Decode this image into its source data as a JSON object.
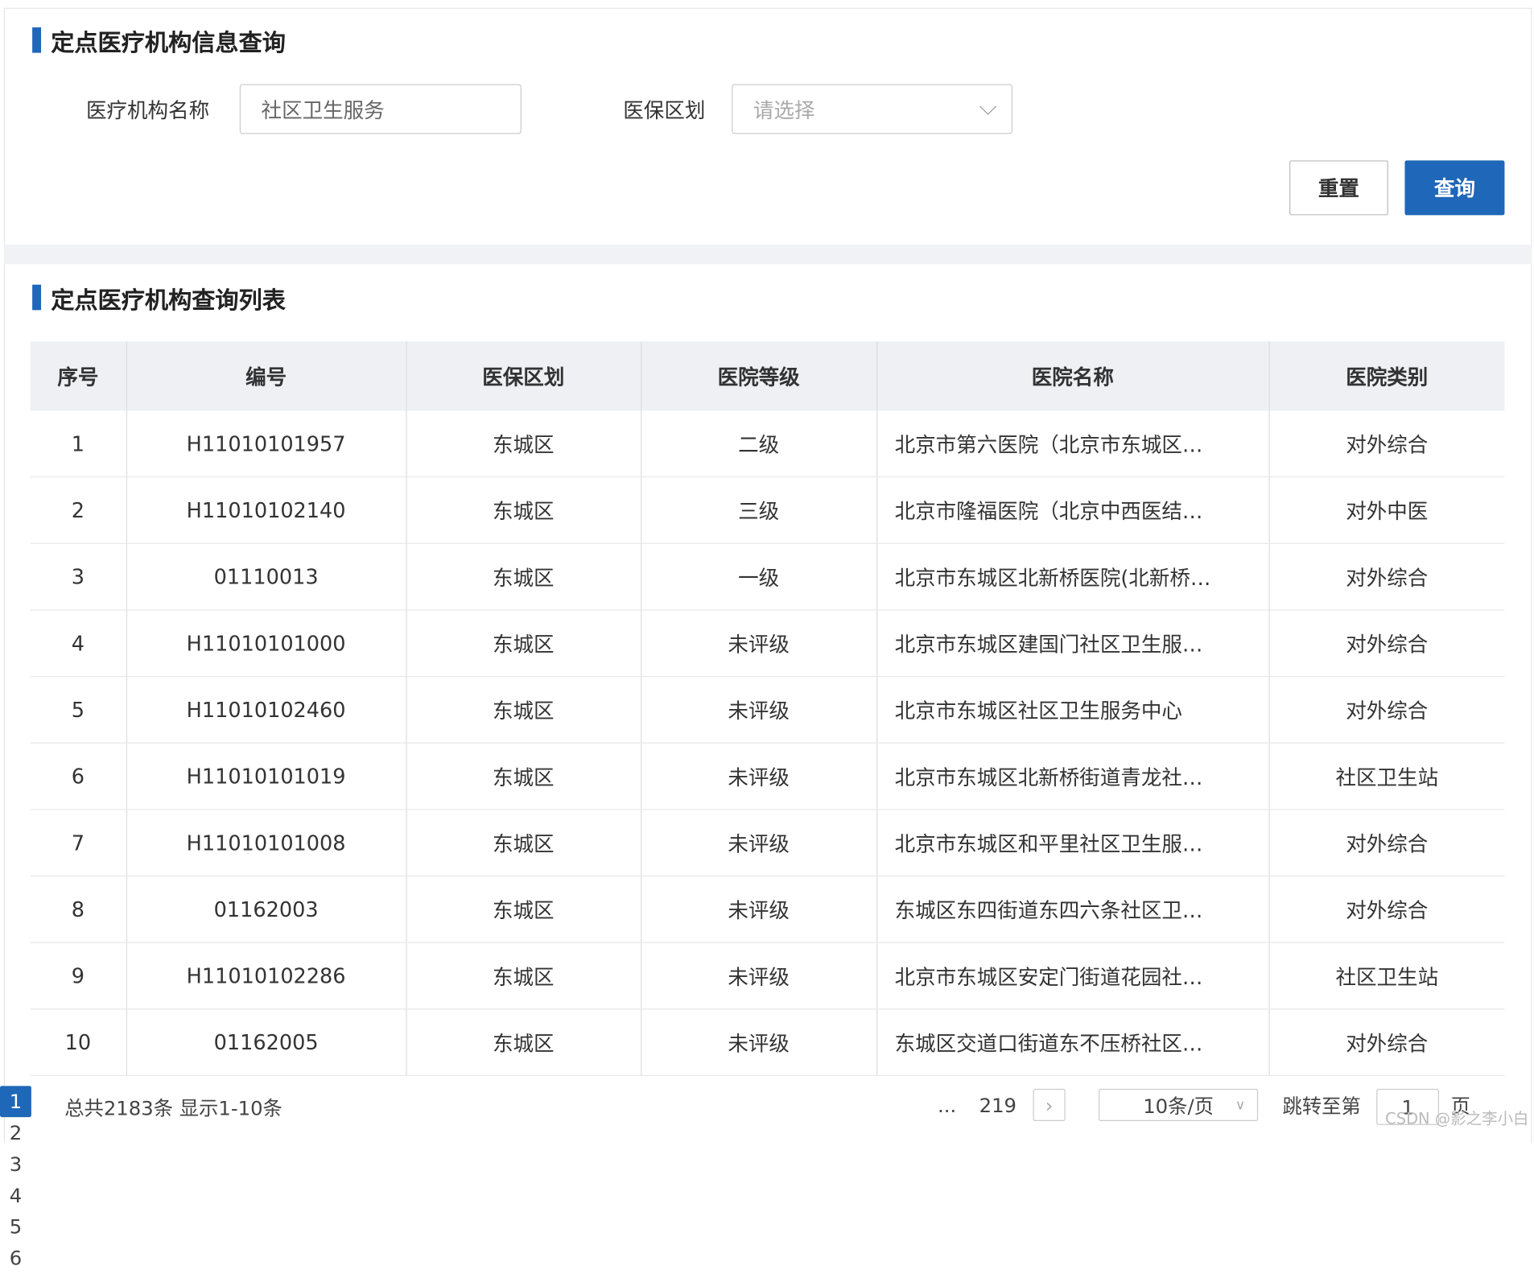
{
  "search": {
    "title": "定点医疗机构信息查询",
    "name_label": "医疗机构名称",
    "name_value": "社区卫生服务",
    "district_label": "医保区划",
    "district_placeholder": "请选择",
    "reset": "重置",
    "query": "查询"
  },
  "list": {
    "title": "定点医疗机构查询列表",
    "columns": [
      "序号",
      "编号",
      "医保区划",
      "医院等级",
      "医院名称",
      "医院类别"
    ],
    "rows": [
      [
        "1",
        "H11010101957",
        "东城区",
        "二级",
        "北京市第六医院（北京市东城区…",
        "对外综合"
      ],
      [
        "2",
        "H11010102140",
        "东城区",
        "三级",
        "北京市隆福医院（北京中西医结…",
        "对外中医"
      ],
      [
        "3",
        "01110013",
        "东城区",
        "一级",
        "北京市东城区北新桥医院(北新桥…",
        "对外综合"
      ],
      [
        "4",
        "H11010101000",
        "东城区",
        "未评级",
        "北京市东城区建国门社区卫生服…",
        "对外综合"
      ],
      [
        "5",
        "H11010102460",
        "东城区",
        "未评级",
        "  北京市东城区社区卫生服务中心",
        "对外综合"
      ],
      [
        "6",
        "H11010101019",
        "东城区",
        "未评级",
        "北京市东城区北新桥街道青龙社…",
        "社区卫生站"
      ],
      [
        "7",
        "H11010101008",
        "东城区",
        "未评级",
        "北京市东城区和平里社区卫生服…",
        "对外综合"
      ],
      [
        "8",
        "01162003",
        "东城区",
        "未评级",
        "东城区东四街道东四六条社区卫…",
        "对外综合"
      ],
      [
        "9",
        "H11010102286",
        "东城区",
        "未评级",
        "北京市东城区安定门街道花园社…",
        "社区卫生站"
      ],
      [
        "10",
        "01162005",
        "东城区",
        "未评级",
        "东城区交道口街道东不压桥社区…",
        "对外综合"
      ]
    ]
  },
  "pagination": {
    "summary": "总共2183条 显示1-10条",
    "pages": [
      "1",
      "2",
      "3",
      "4",
      "5",
      "6"
    ],
    "ellipsis": "...",
    "last": "219",
    "current": "1",
    "next_icon": "chevron-right",
    "page_size": "10条/页",
    "jump_label": "跳转至第",
    "jump_value": "1",
    "page_unit": "页"
  },
  "watermark": "CSDN @影之李小白",
  "colors": {
    "accent": "#1f67b8",
    "header_bg": "#eef0f4"
  }
}
